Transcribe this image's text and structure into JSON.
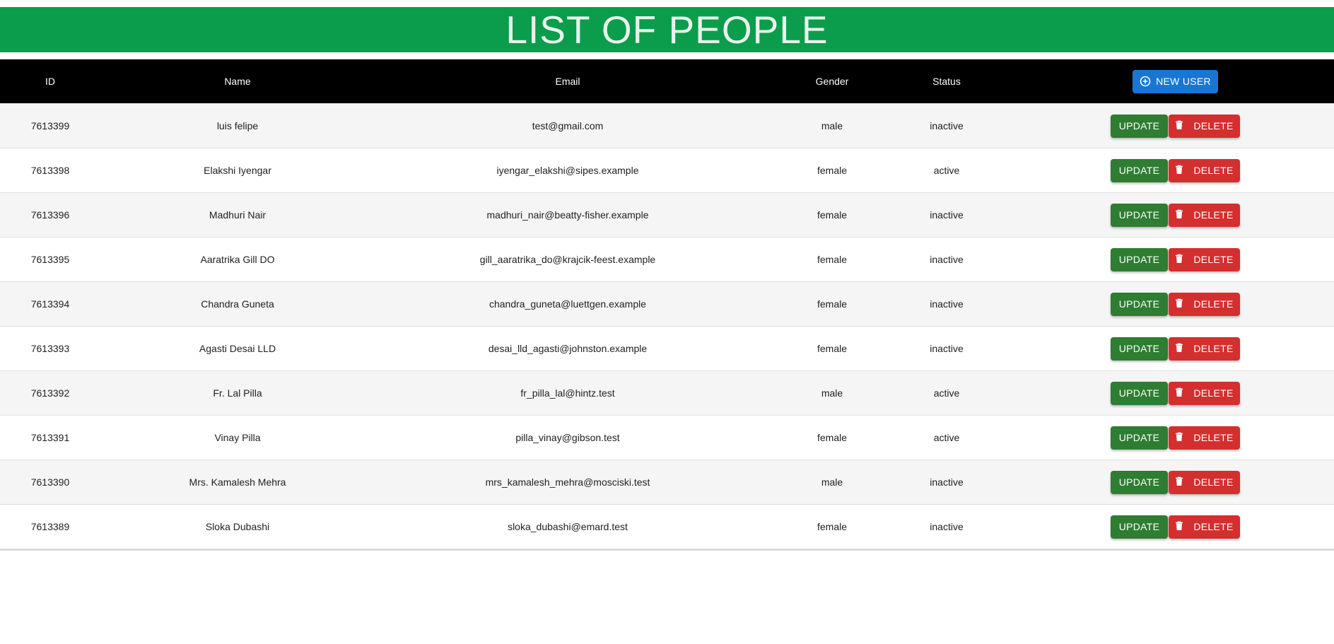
{
  "page": {
    "title": "LIST OF PEOPLE"
  },
  "colors": {
    "banner": "#0b9d4c",
    "header_bg": "#000000",
    "new_user_button": "#1976d2",
    "update_button": "#2e7d32",
    "delete_button": "#d32f2f"
  },
  "table": {
    "columns": {
      "id": "ID",
      "name": "Name",
      "email": "Email",
      "gender": "Gender",
      "status": "Status"
    },
    "new_user_label": "NEW USER",
    "new_user_icon": "add-circle-icon",
    "update_label": "UPDATE",
    "delete_label": "DELETE",
    "delete_icon": "trash-icon",
    "rows": [
      {
        "id": "7613399",
        "name": "luis felipe",
        "email": "test@gmail.com",
        "gender": "male",
        "status": "inactive"
      },
      {
        "id": "7613398",
        "name": "Elakshi Iyengar",
        "email": "iyengar_elakshi@sipes.example",
        "gender": "female",
        "status": "active"
      },
      {
        "id": "7613396",
        "name": "Madhuri Nair",
        "email": "madhuri_nair@beatty-fisher.example",
        "gender": "female",
        "status": "inactive"
      },
      {
        "id": "7613395",
        "name": "Aaratrika Gill DO",
        "email": "gill_aaratrika_do@krajcik-feest.example",
        "gender": "female",
        "status": "inactive"
      },
      {
        "id": "7613394",
        "name": "Chandra Guneta",
        "email": "chandra_guneta@luettgen.example",
        "gender": "female",
        "status": "inactive"
      },
      {
        "id": "7613393",
        "name": "Agasti Desai LLD",
        "email": "desai_lld_agasti@johnston.example",
        "gender": "female",
        "status": "inactive"
      },
      {
        "id": "7613392",
        "name": "Fr. Lal Pilla",
        "email": "fr_pilla_lal@hintz.test",
        "gender": "male",
        "status": "active"
      },
      {
        "id": "7613391",
        "name": "Vinay Pilla",
        "email": "pilla_vinay@gibson.test",
        "gender": "female",
        "status": "active"
      },
      {
        "id": "7613390",
        "name": "Mrs. Kamalesh Mehra",
        "email": "mrs_kamalesh_mehra@mosciski.test",
        "gender": "male",
        "status": "inactive"
      },
      {
        "id": "7613389",
        "name": "Sloka Dubashi",
        "email": "sloka_dubashi@emard.test",
        "gender": "female",
        "status": "inactive"
      }
    ]
  }
}
